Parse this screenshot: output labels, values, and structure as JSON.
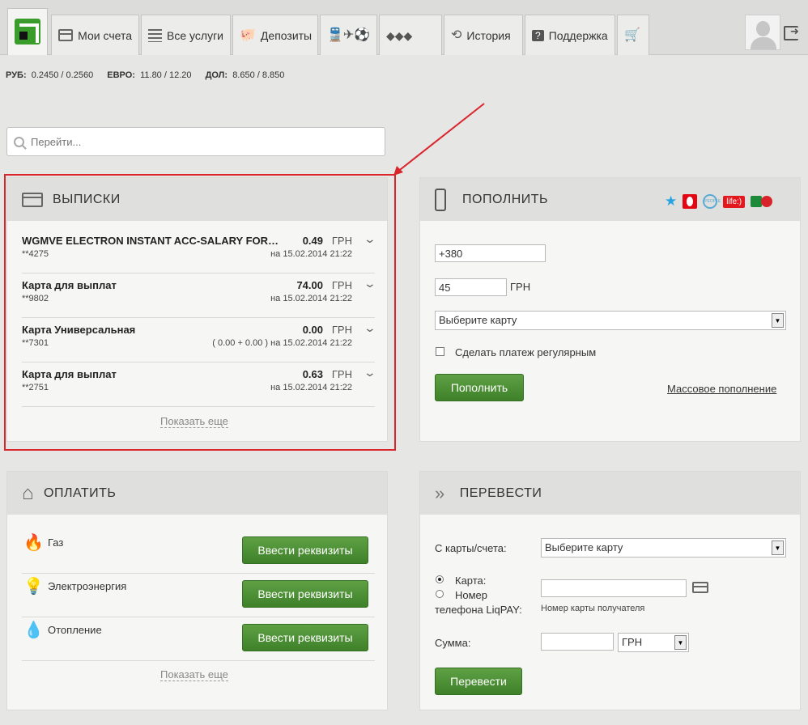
{
  "nav": {
    "tabs": [
      {
        "label": "Мои счета",
        "icon": "card-icon"
      },
      {
        "label": "Все услуги",
        "icon": "list-icon"
      },
      {
        "label": "Депозиты",
        "icon": "piggy-bank-icon"
      },
      {
        "label": "",
        "icon": "transport-icon"
      },
      {
        "label": "",
        "icon": "mobile-apps-icon"
      },
      {
        "label": "История",
        "icon": "history-icon"
      },
      {
        "label": "Поддержка",
        "icon": "help-icon"
      },
      {
        "label": "",
        "icon": "cart-icon"
      }
    ]
  },
  "rates": {
    "rub_label": "РУБ:",
    "rub_value": "0.2450 / 0.2560",
    "eur_label": "ЕВРО:",
    "eur_value": "11.80 / 12.20",
    "usd_label": "ДОЛ:",
    "usd_value": "8.650 / 8.850"
  },
  "search": {
    "placeholder": "Перейти..."
  },
  "statements": {
    "title": "ВЫПИСКИ",
    "items": [
      {
        "name": "WGMVE ELECTRON INSTANT ACC-SALARY FOR PENSIONERS",
        "number": "**4275",
        "amount": "0.49",
        "currency": "ГРН",
        "date": "на 15.02.2014 21:22"
      },
      {
        "name": "Карта для выплат",
        "number": "**9802",
        "amount": "74.00",
        "currency": "ГРН",
        "date": "на 15.02.2014 21:22"
      },
      {
        "name": "Карта Универсальная",
        "number": "**7301",
        "amount": "0.00",
        "currency": "ГРН",
        "date": "( 0.00 + 0.00 ) на 15.02.2014 21:22"
      },
      {
        "name": "Карта для выплат",
        "number": "**2751",
        "amount": "0.63",
        "currency": "ГРН",
        "date": "на 15.02.2014 21:22"
      }
    ],
    "show_more": "Показать еще"
  },
  "topup": {
    "title": "ПОПОЛНИТЬ",
    "phone_value": "+380",
    "amount_value": "45",
    "currency": "ГРН",
    "card_select": "Выберите карту",
    "regular_label": "Сделать платеж регулярным",
    "submit_label": "Пополнить",
    "mass_link": "Массовое пополнение",
    "operators": [
      "kyivstar-icon",
      "mts-icon",
      "people-net-icon",
      "life-icon",
      "intertelecom-icon"
    ],
    "life_text": "life:)"
  },
  "pay": {
    "title": "ОПЛАТИТЬ",
    "items": [
      {
        "name": "Газ",
        "button": "Ввести реквизиты",
        "icon": "gas-flame-icon"
      },
      {
        "name": "Электроэнергия",
        "button": "Ввести реквизиты",
        "icon": "lightbulb-icon"
      },
      {
        "name": "Отопление",
        "button": "Ввести реквизиты",
        "icon": "heating-drop-icon"
      }
    ],
    "show_more": "Показать еще"
  },
  "transfer": {
    "title": "ПЕРЕВЕСТИ",
    "from_label": "С карты/счета:",
    "from_select": "Выберите карту",
    "radio_card": "Карта:",
    "radio_phone_1": "Номер",
    "radio_phone_2": "телефона LiqPAY:",
    "recipient_hint": "Номер карты получателя",
    "sum_label": "Сумма:",
    "currency_select": "ГРН",
    "submit_label": "Перевести"
  }
}
